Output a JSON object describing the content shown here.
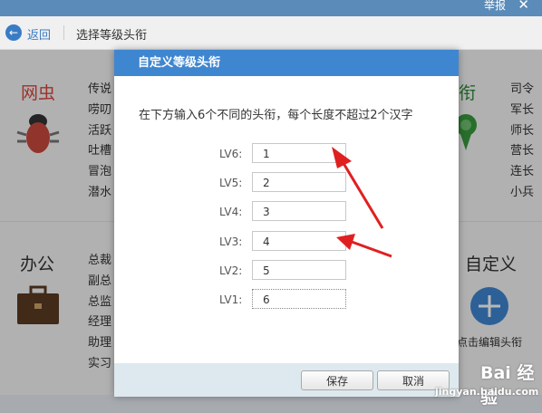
{
  "topbar": {
    "report_label": "举报",
    "close_label": "✕"
  },
  "nav": {
    "back_label": "返回",
    "title": "选择等级头衔"
  },
  "categories": {
    "wangchong": {
      "title": "网虫",
      "items": [
        "传说",
        "唠叨",
        "活跃",
        "吐槽",
        "冒泡",
        "潜水"
      ]
    },
    "military": {
      "title": "衔",
      "items": [
        "司令",
        "军长",
        "师长",
        "营长",
        "连长",
        "小兵"
      ]
    },
    "office": {
      "title": "办公",
      "items": [
        "总裁",
        "副总",
        "总监",
        "经理",
        "助理",
        "实习"
      ]
    },
    "custom": {
      "title": "自定义",
      "hint": "点击编辑头衔"
    }
  },
  "dialog": {
    "title": "自定义等级头衔",
    "description": "在下方输入6个不同的头衔，每个长度不超过2个汉字",
    "levels": [
      {
        "label": "LV6:",
        "value": "1"
      },
      {
        "label": "LV5:",
        "value": "2"
      },
      {
        "label": "LV4:",
        "value": "3"
      },
      {
        "label": "LV3:",
        "value": "4"
      },
      {
        "label": "LV2:",
        "value": "5"
      },
      {
        "label": "LV1:",
        "value": "6"
      }
    ],
    "save_label": "保存",
    "cancel_label": "取消"
  },
  "watermark": {
    "text": "Bai 经验",
    "url": "jingyan.baidu.com"
  },
  "colors": {
    "accent": "#3f86d1",
    "category_red": "#d9453b",
    "military_green": "#2e8b3a",
    "annotation_arrow": "#e02020"
  }
}
